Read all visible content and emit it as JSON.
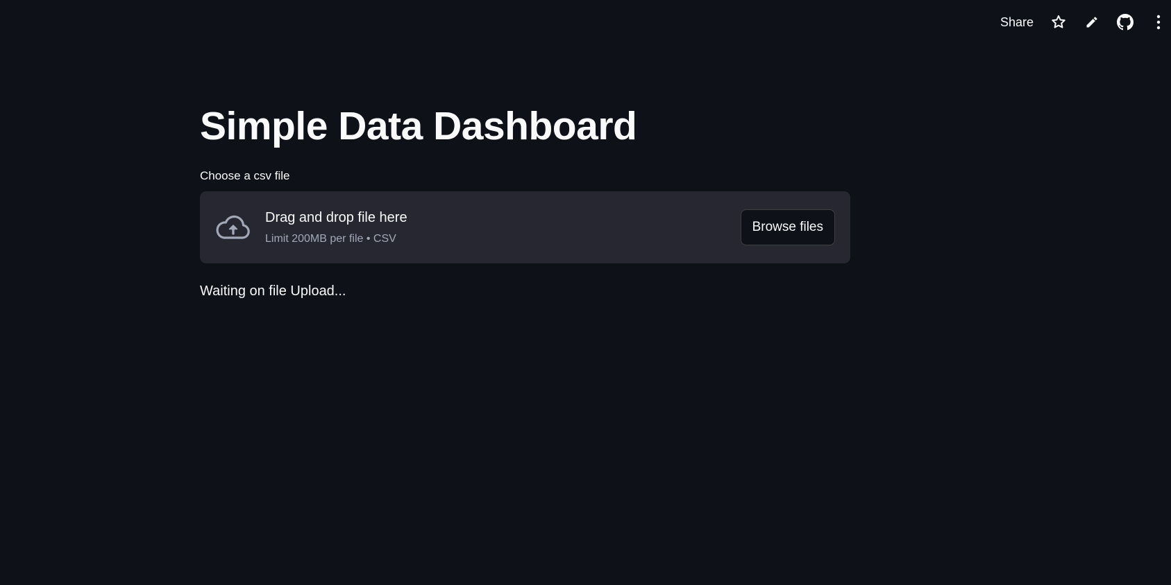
{
  "toolbar": {
    "share_label": "Share",
    "icons": [
      "star-icon",
      "pencil-icon",
      "github-icon",
      "more-vertical-icon"
    ]
  },
  "main": {
    "title": "Simple Data Dashboard",
    "uploader": {
      "label": "Choose a csv file",
      "drop_text": "Drag and drop file here",
      "limit_text": "Limit 200MB per file • CSV",
      "browse_label": "Browse files",
      "icon": "cloud-upload-icon"
    },
    "status": "Waiting on file Upload..."
  },
  "colors": {
    "background": "#0e1117",
    "dropzone": "#262730",
    "text": "#fafafa",
    "muted_text": "#a3a8b8"
  }
}
